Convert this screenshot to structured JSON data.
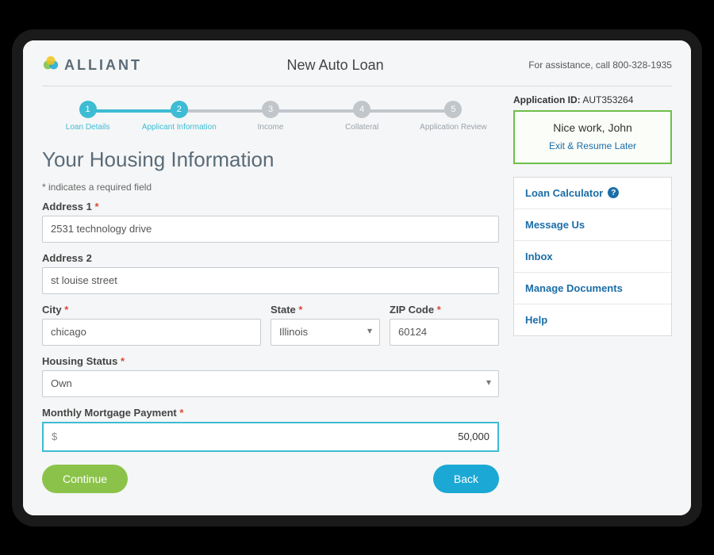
{
  "header": {
    "brand": "ALLIANT",
    "page_title": "New Auto Loan",
    "assistance": "For assistance, call 800-328-1935"
  },
  "stepper": {
    "steps": [
      {
        "num": "1",
        "label": "Loan Details",
        "active": true
      },
      {
        "num": "2",
        "label": "Applicant Information",
        "active": true
      },
      {
        "num": "3",
        "label": "Income",
        "active": false
      },
      {
        "num": "4",
        "label": "Collateral",
        "active": false
      },
      {
        "num": "5",
        "label": "Application Review",
        "active": false
      }
    ]
  },
  "section": {
    "heading": "Your Housing Information",
    "required_note": "* indicates a required field"
  },
  "form": {
    "address1_label": "Address 1",
    "address1_value": "2531 technology drive",
    "address2_label": "Address 2",
    "address2_value": "st louise street",
    "city_label": "City",
    "city_value": "chicago",
    "state_label": "State",
    "state_value": "Illinois",
    "zip_label": "ZIP Code",
    "zip_value": "60124",
    "housing_status_label": "Housing Status",
    "housing_status_value": "Own",
    "mortgage_label": "Monthly Mortgage Payment",
    "mortgage_prefix": "$",
    "mortgage_value": "50,000",
    "asterisk": "*"
  },
  "buttons": {
    "continue": "Continue",
    "back": "Back"
  },
  "sidebar": {
    "app_id_label": "Application ID:",
    "app_id_value": "AUT353264",
    "greeting": "Nice work, John",
    "exit_label": "Exit & Resume Later",
    "links": [
      "Loan Calculator",
      "Message Us",
      "Inbox",
      "Manage Documents",
      "Help"
    ],
    "info_glyph": "?"
  }
}
